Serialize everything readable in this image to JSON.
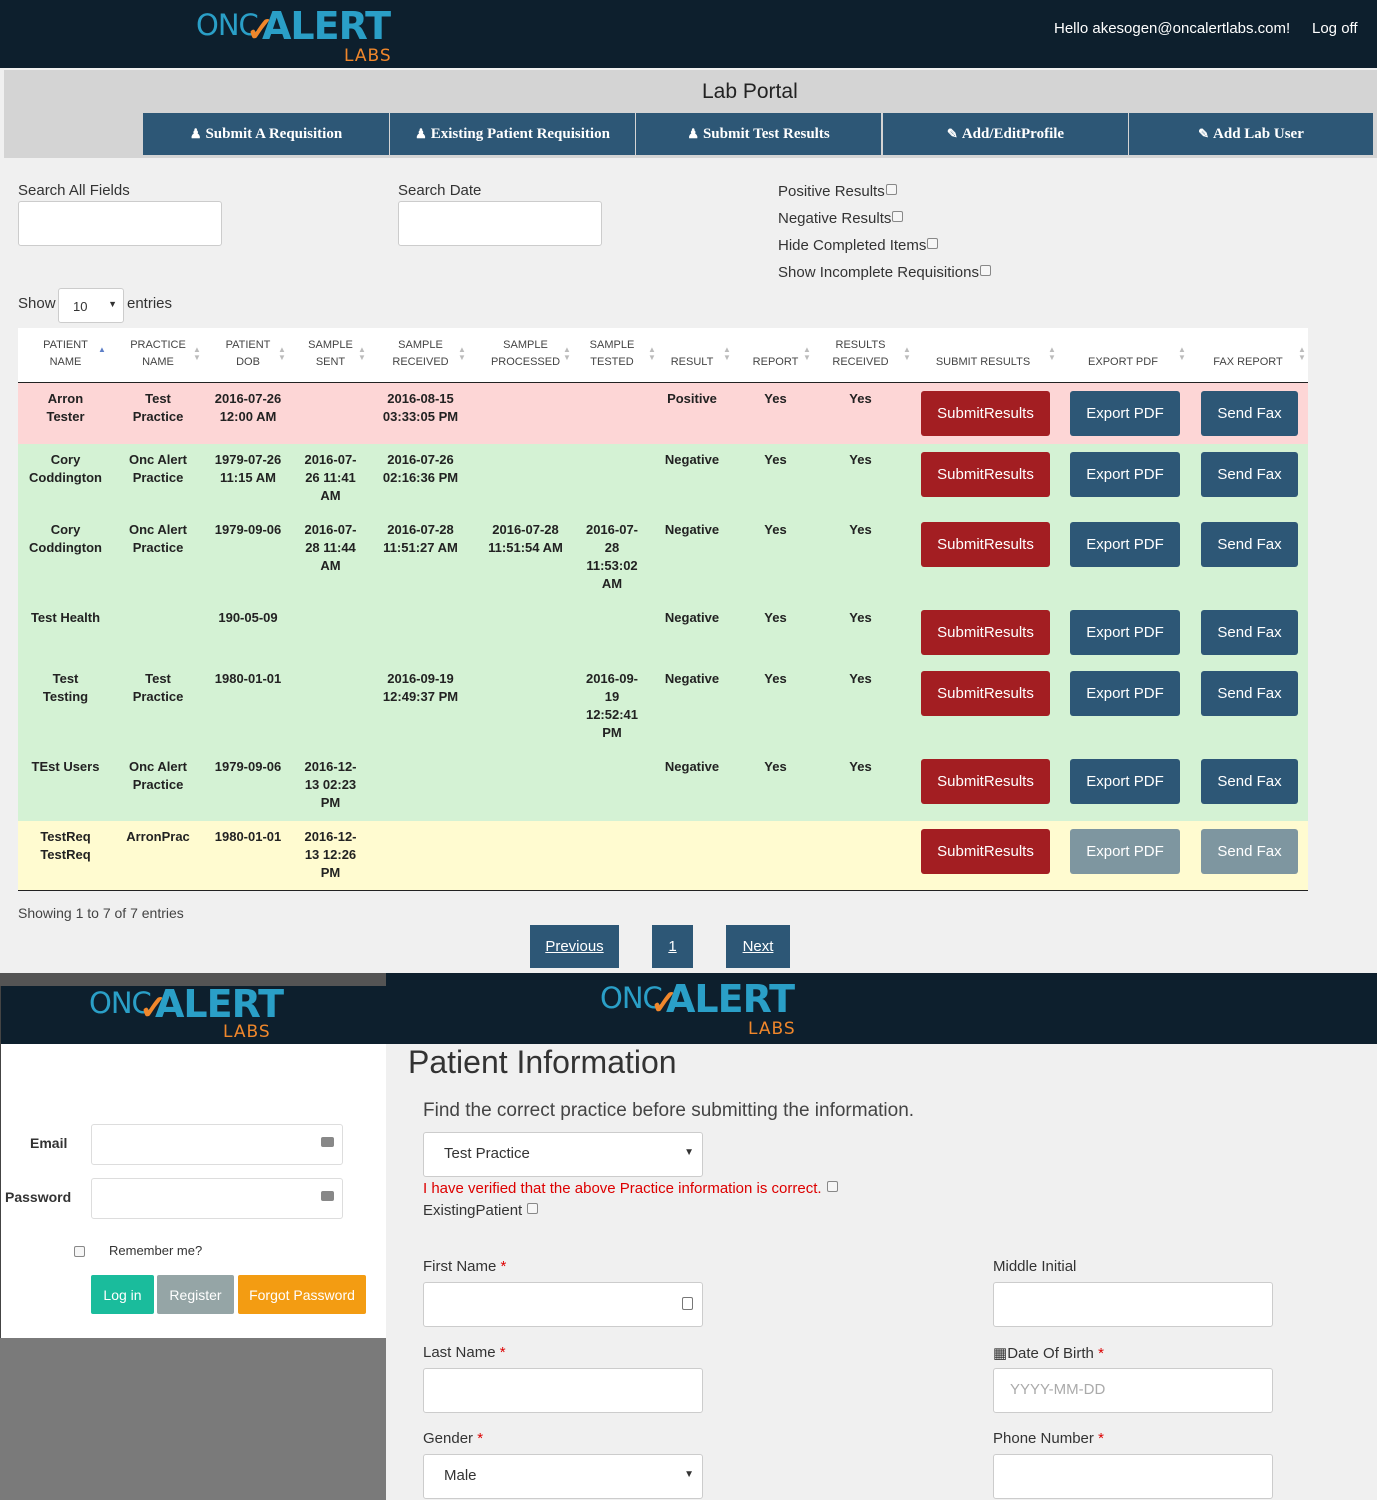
{
  "header": {
    "logo_onc": "ONC",
    "logo_alert": "ALERT",
    "logo_labs": "LABS",
    "greeting": "Hello akesogen@oncalertlabs.com!",
    "logoff": "Log off"
  },
  "portal": {
    "title": "Lab Portal",
    "nav": [
      {
        "label": "Submit A Requisition",
        "icon": "person-icon"
      },
      {
        "label": "Existing Patient Requisition",
        "icon": "person-icon"
      },
      {
        "label": "Submit Test Results",
        "icon": "person-icon"
      },
      {
        "label": "Add/EditProfile",
        "icon": "edit-icon"
      },
      {
        "label": "Add Lab User",
        "icon": "edit-icon"
      }
    ]
  },
  "filters": {
    "search_all_label": "Search All Fields",
    "search_all_value": "",
    "search_date_label": "Search Date",
    "search_date_value": "",
    "checkboxes": [
      "Positive Results",
      "Negative Results",
      "Hide Completed Items",
      "Show Incomplete Requisitions"
    ],
    "show_label": "Show",
    "entries_value": "10",
    "entries_label": "entries"
  },
  "table": {
    "columns": [
      [
        "PATIENT",
        "NAME"
      ],
      [
        "PRACTICE",
        "NAME"
      ],
      [
        "PATIENT",
        "DOB"
      ],
      [
        "SAMPLE",
        "SENT"
      ],
      [
        "SAMPLE",
        "RECEIVED"
      ],
      [
        "SAMPLE",
        "PROCESSED"
      ],
      [
        "SAMPLE",
        "TESTED"
      ],
      [
        "RESULT",
        ""
      ],
      [
        "REPORT",
        ""
      ],
      [
        "RESULTS",
        "RECEIVED"
      ],
      [
        "SUBMIT RESULTS",
        ""
      ],
      [
        "EXPORT PDF",
        ""
      ],
      [
        "FAX REPORT",
        ""
      ]
    ],
    "button_labels": {
      "submit": "SubmitResults",
      "export": "Export PDF",
      "fax": "Send Fax"
    },
    "rows": [
      {
        "status": "positive",
        "name": [
          "Arron",
          "Tester"
        ],
        "practice": [
          "Test",
          "Practice"
        ],
        "dob": [
          "2016-07-26",
          "12:00 AM"
        ],
        "sent": [],
        "received": [
          "2016-08-15",
          "03:33:05 PM"
        ],
        "processed": [],
        "tested": [],
        "result": "Positive",
        "report": "Yes",
        "results_received": "Yes"
      },
      {
        "status": "negative",
        "name": [
          "Cory",
          "Coddington"
        ],
        "practice": [
          "Onc Alert",
          "Practice"
        ],
        "dob": [
          "1979-07-26",
          "11:15 AM"
        ],
        "sent": [
          "2016-07-",
          "26 11:41",
          "AM"
        ],
        "received": [
          "2016-07-26",
          "02:16:36 PM"
        ],
        "processed": [],
        "tested": [],
        "result": "Negative",
        "report": "Yes",
        "results_received": "Yes"
      },
      {
        "status": "negative",
        "name": [
          "Cory",
          "Coddington"
        ],
        "practice": [
          "Onc Alert",
          "Practice"
        ],
        "dob": [
          "1979-09-06"
        ],
        "sent": [
          "2016-07-",
          "28 11:44",
          "AM"
        ],
        "received": [
          "2016-07-28",
          "11:51:27 AM"
        ],
        "processed": [
          "2016-07-28",
          "11:51:54 AM"
        ],
        "tested": [
          "2016-07-",
          "28",
          "11:53:02",
          "AM"
        ],
        "result": "Negative",
        "report": "Yes",
        "results_received": "Yes"
      },
      {
        "status": "negative",
        "name": [
          "Test Health"
        ],
        "practice": [],
        "dob": [
          "190-05-09"
        ],
        "sent": [],
        "received": [],
        "processed": [],
        "tested": [],
        "result": "Negative",
        "report": "Yes",
        "results_received": "Yes"
      },
      {
        "status": "negative",
        "name": [
          "Test",
          "Testing"
        ],
        "practice": [
          "Test",
          "Practice"
        ],
        "dob": [
          "1980-01-01"
        ],
        "sent": [],
        "received": [
          "2016-09-19",
          "12:49:37 PM"
        ],
        "processed": [],
        "tested": [
          "2016-09-",
          "19",
          "12:52:41",
          "PM"
        ],
        "result": "Negative",
        "report": "Yes",
        "results_received": "Yes"
      },
      {
        "status": "negative",
        "name": [
          "TEst Users"
        ],
        "practice": [
          "Onc Alert",
          "Practice"
        ],
        "dob": [
          "1979-09-06"
        ],
        "sent": [
          "2016-12-",
          "13 02:23",
          "PM"
        ],
        "received": [],
        "processed": [],
        "tested": [],
        "result": "Negative",
        "report": "Yes",
        "results_received": "Yes"
      },
      {
        "status": "incomplete",
        "name": [
          "TestReq",
          "TestReq"
        ],
        "practice": [
          "ArronPrac"
        ],
        "dob": [
          "1980-01-01"
        ],
        "sent": [
          "2016-12-",
          "13 12:26",
          "PM"
        ],
        "received": [],
        "processed": [],
        "tested": [],
        "result": "",
        "report": "",
        "results_received": ""
      }
    ]
  },
  "pagination": {
    "info": "Showing 1 to 7 of 7 entries",
    "previous": "Previous",
    "page": "1",
    "next": "Next"
  },
  "login": {
    "email_label": "Email",
    "password_label": "Password",
    "remember": "Remember me?",
    "login_btn": "Log in",
    "register_btn": "Register",
    "forgot_btn": "Forgot Password"
  },
  "patient_form": {
    "title": "Patient Information",
    "find_text": "Find the correct practice before submitting the information.",
    "practice_value": "Test Practice",
    "verify_text": "I have verified that the above Practice information is correct.",
    "existing_label": "ExistingPatient",
    "first_name_label": "First Name",
    "middle_initial_label": "Middle Initial",
    "last_name_label": "Last Name",
    "dob_label": "Date Of Birth",
    "dob_placeholder": "YYYY-MM-DD",
    "gender_label": "Gender",
    "gender_value": "Male",
    "phone_label": "Phone Number",
    "required_mark": "*"
  },
  "colors": {
    "header_bg": "#0d1f2d",
    "nav_btn": "#2d5776",
    "submit_red": "#a31e22",
    "positive_row": "#fdd6d6",
    "negative_row": "#d4f2d4",
    "incomplete_row": "#fffbd0",
    "login_green": "#1abc9c",
    "register_grey": "#95a5a6",
    "forgot_orange": "#f39c12"
  }
}
